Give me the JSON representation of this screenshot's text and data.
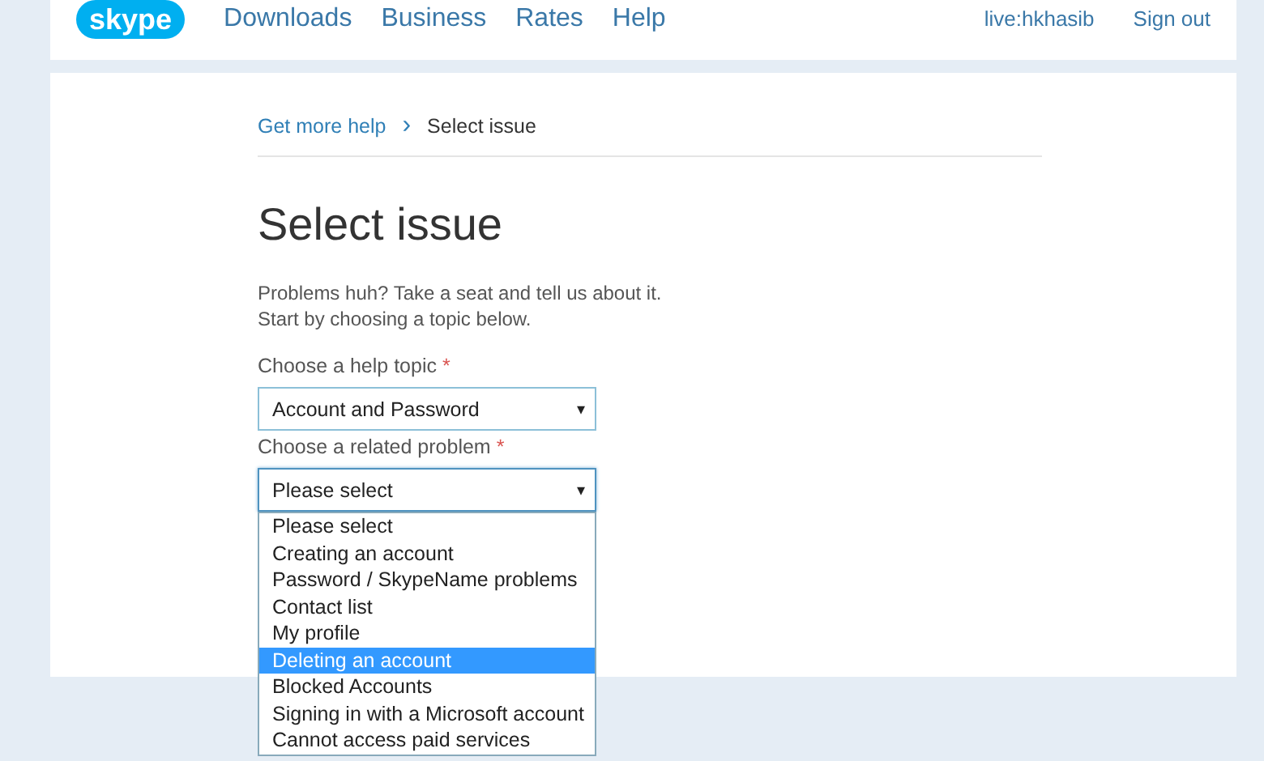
{
  "header": {
    "logo": "skype",
    "nav": [
      "Downloads",
      "Business",
      "Rates",
      "Help"
    ],
    "user": "live:hkhasib",
    "sign_out": "Sign out"
  },
  "breadcrumb": {
    "link": "Get more help",
    "separator": "›",
    "current": "Select issue"
  },
  "title": "Select issue",
  "intro": [
    "Problems huh? Take a seat and tell us about it.",
    "Start by choosing a topic below."
  ],
  "fields": [
    {
      "label": "Choose a help topic",
      "required": "*",
      "value": "Account and Password",
      "focused": false,
      "caret": "▾"
    },
    {
      "label": "Choose a related problem",
      "required": "*",
      "value": "Please select",
      "focused": true,
      "caret": "▾"
    }
  ],
  "options": [
    {
      "label": "Please select",
      "selected": false
    },
    {
      "label": "Creating an account",
      "selected": false
    },
    {
      "label": "Password / SkypeName problems",
      "selected": false
    },
    {
      "label": "Contact list",
      "selected": false
    },
    {
      "label": "My profile",
      "selected": false
    },
    {
      "label": "Deleting an account",
      "selected": true
    },
    {
      "label": "Blocked Accounts",
      "selected": false
    },
    {
      "label": "Signing in with a Microsoft account",
      "selected": false
    },
    {
      "label": "Cannot access paid services",
      "selected": false
    }
  ]
}
